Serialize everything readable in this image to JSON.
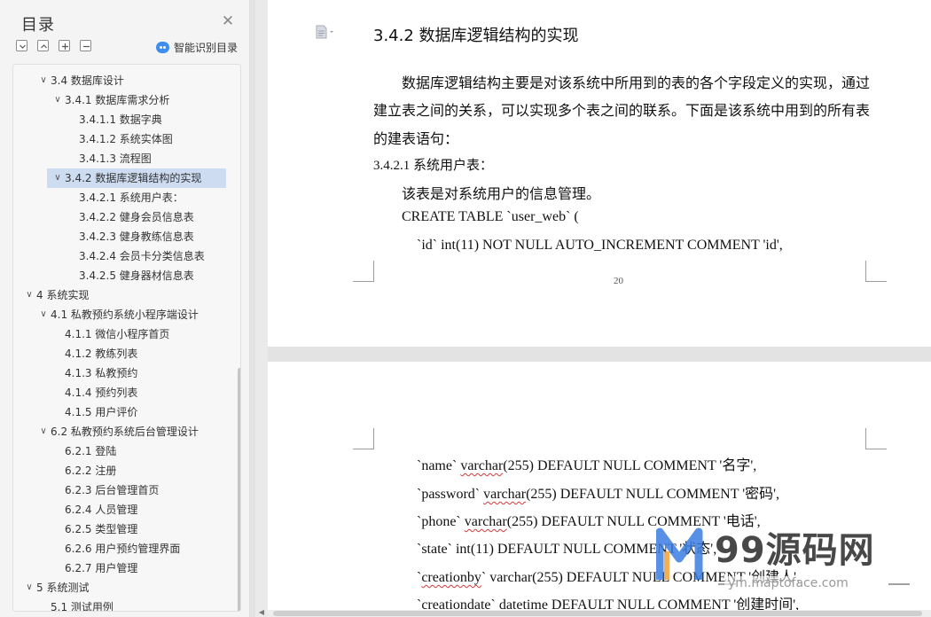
{
  "sidebar": {
    "title": "目录",
    "smart_toc_label": "智能识别目录",
    "toolbar_icons": [
      "collapse-all-icon",
      "expand-all-icon",
      "add-heading-icon",
      "remove-heading-icon"
    ],
    "items": [
      {
        "label": "3.4 数据库设计",
        "level": 1,
        "expanded": true
      },
      {
        "label": "3.4.1 数据库需求分析",
        "level": 2,
        "expanded": true
      },
      {
        "label": "3.4.1.1 数据字典",
        "level": 3
      },
      {
        "label": "3.4.1.2 系统实体图",
        "level": 3
      },
      {
        "label": "3.4.1.3 流程图",
        "level": 3
      },
      {
        "label": "3.4.2 数据库逻辑结构的实现",
        "level": 2,
        "expanded": true,
        "active": true
      },
      {
        "label": "3.4.2.1  系统用户表：",
        "level": 3
      },
      {
        "label": "3.4.2.2 健身会员信息表",
        "level": 3
      },
      {
        "label": "3.4.2.3 健身教练信息表",
        "level": 3
      },
      {
        "label": "3.4.2.4 会员卡分类信息表",
        "level": 3
      },
      {
        "label": "3.4.2.5 健身器材信息表",
        "level": 3
      },
      {
        "label": "4 系统实现",
        "level": 0,
        "expanded": true
      },
      {
        "label": "4.1 私教预约系统小程序端设计",
        "level": 1,
        "expanded": true
      },
      {
        "label": "4.1.1 微信小程序首页",
        "level": 2
      },
      {
        "label": "4.1.2 教练列表",
        "level": 2
      },
      {
        "label": "4.1.3 私教预约",
        "level": 2
      },
      {
        "label": "4.1.4 预约列表",
        "level": 2
      },
      {
        "label": "4.1.5 用户评价",
        "level": 2
      },
      {
        "label": "6.2  私教预约系统后台管理设计",
        "level": 1,
        "expanded": true
      },
      {
        "label": "6.2.1 登陆",
        "level": 2
      },
      {
        "label": "6.2.2 注册",
        "level": 2
      },
      {
        "label": "6.2.3 后台管理首页",
        "level": 2
      },
      {
        "label": "6.2.4 人员管理",
        "level": 2
      },
      {
        "label": "6.2.5 类型管理",
        "level": 2
      },
      {
        "label": "6.2.6 用户预约管理界面",
        "level": 2
      },
      {
        "label": "6.2.7 用户管理",
        "level": 2
      },
      {
        "label": "5 系统测试",
        "level": 0,
        "expanded": true
      },
      {
        "label": "5.1 测试用例",
        "level": 1
      }
    ]
  },
  "document": {
    "page1": {
      "heading": "3.4.2 数据库逻辑结构的实现",
      "para_line1": "数据库逻辑结构主要是对该系统中所用到的表的各个字段定义的实现，通过",
      "para_line2": "建立表之间的关系，可以实现多个表之间的联系。下面是该系统中用到的所有表",
      "para_line3": "的建表语句：",
      "subheading": "3.4.2.1  系统用户表：",
      "desc": "该表是对系统用户的信息管理。",
      "sql_create": "CREATE TABLE `user_web` (",
      "sql_id": "`id` int(11) NOT NULL AUTO_INCREMENT COMMENT 'id',",
      "page_number": "20"
    },
    "page2": {
      "lines": [
        {
          "pre": "`name` ",
          "sq": "varchar",
          "post": "(255) DEFAULT NULL COMMENT '名字',"
        },
        {
          "pre": "`password` ",
          "sq": "varchar",
          "post": "(255) DEFAULT NULL COMMENT '密码',"
        },
        {
          "pre": "`phone` ",
          "sq": "varchar",
          "post": "(255) DEFAULT NULL COMMENT '电话',"
        },
        {
          "pre": "`state` int(11) DEFAULT NULL COMMENT '状态',",
          "sq": "",
          "post": ""
        },
        {
          "pre": "`",
          "sq": "creationby",
          "post": "` varchar(255) DEFAULT NULL COMMENT '创建人',"
        },
        {
          "pre": "`",
          "sq": "creationdate",
          "post": "` datetime DEFAULT NULL COMMENT '创建时间',"
        }
      ]
    }
  },
  "watermark": {
    "brand": "99源码网",
    "url": "ym.maptoface.com"
  },
  "colors": {
    "active_item_bg": "#cddcf1",
    "smart_icon": "#3d8ef0",
    "spell_underline": "#d23a3a"
  }
}
